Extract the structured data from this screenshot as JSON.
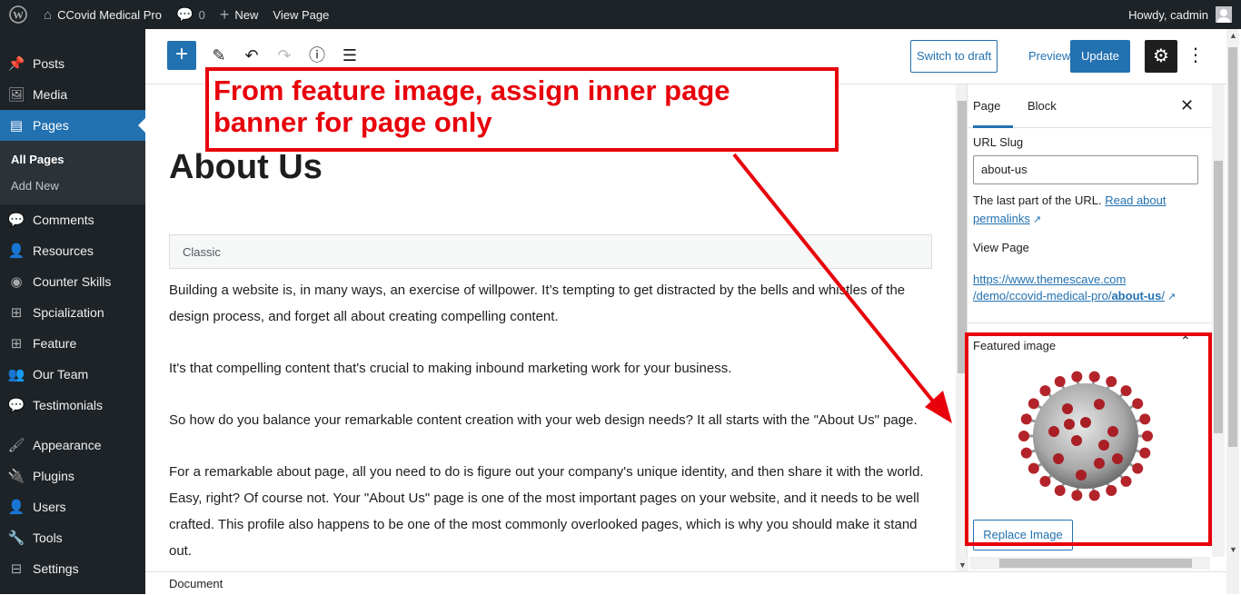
{
  "adminbar": {
    "site_name": "CCovid Medical Pro",
    "comments_count": "0",
    "new_label": "New",
    "view_page": "View Page",
    "howdy": "Howdy, cadmin"
  },
  "sidebar": {
    "items_top": [
      {
        "label": "Posts",
        "icon": "pin-icon"
      },
      {
        "label": "Media",
        "icon": "media-icon"
      },
      {
        "label": "Pages",
        "icon": "pages-icon"
      }
    ],
    "submenu": [
      "All Pages",
      "Add New"
    ],
    "items_bottom": [
      {
        "label": "Comments",
        "icon": "comments-icon"
      },
      {
        "label": "Resources",
        "icon": "user-icon"
      },
      {
        "label": "Counter Skills",
        "icon": "counter-icon"
      },
      {
        "label": "Spcialization",
        "icon": "sitemap-icon"
      },
      {
        "label": "Feature",
        "icon": "sitemap-icon"
      },
      {
        "label": "Our Team",
        "icon": "groups-icon"
      },
      {
        "label": "Testimonials",
        "icon": "comments-icon"
      }
    ],
    "items_admin": [
      {
        "label": "Appearance",
        "icon": "brush-icon"
      },
      {
        "label": "Plugins",
        "icon": "plugin-icon"
      },
      {
        "label": "Users",
        "icon": "users-icon"
      },
      {
        "label": "Tools",
        "icon": "wrench-icon"
      },
      {
        "label": "Settings",
        "icon": "settings-icon"
      }
    ]
  },
  "toolbar": {
    "switch_draft": "Switch to draft",
    "preview": "Preview",
    "update": "Update"
  },
  "content": {
    "title": "About Us",
    "classic_label": "Classic",
    "paragraphs": [
      "Building a website is, in many ways, an exercise of willpower. It’s tempting to get distracted by the bells and whistles of the design process, and forget all about creating compelling content.",
      "It's that compelling content that's crucial to making inbound marketing work for your business.",
      "So how do you balance your remarkable content creation with your web design needs? It all starts with the \"About Us\" page.",
      "For a remarkable about page, all you need to do is figure out your company's unique identity, and then share it with the world. Easy, right? Of course not. Your \"About Us\" page is one of the most important pages on your website, and it needs to be well crafted. This profile also happens to be one of the most commonly overlooked pages, which is why you should make it stand out."
    ]
  },
  "settings": {
    "tab_page": "Page",
    "tab_block": "Block",
    "url_slug_label": "URL Slug",
    "url_slug_value": "about-us",
    "help_text": "The last part of the URL.",
    "help_link": "Read about permalinks",
    "view_page_label": "View Page",
    "permalink_line1": "https://www.themescave.com",
    "permalink_line2": "/demo/ccovid-medical-pro/",
    "permalink_bold": "about-us",
    "permalink_end": "/",
    "featured_image_title": "Featured image",
    "replace_image": "Replace Image"
  },
  "footer": {
    "breadcrumb": "Document"
  },
  "annotation": {
    "text": "From feature image, assign inner page banner for page only",
    "color": "#e8000b"
  }
}
